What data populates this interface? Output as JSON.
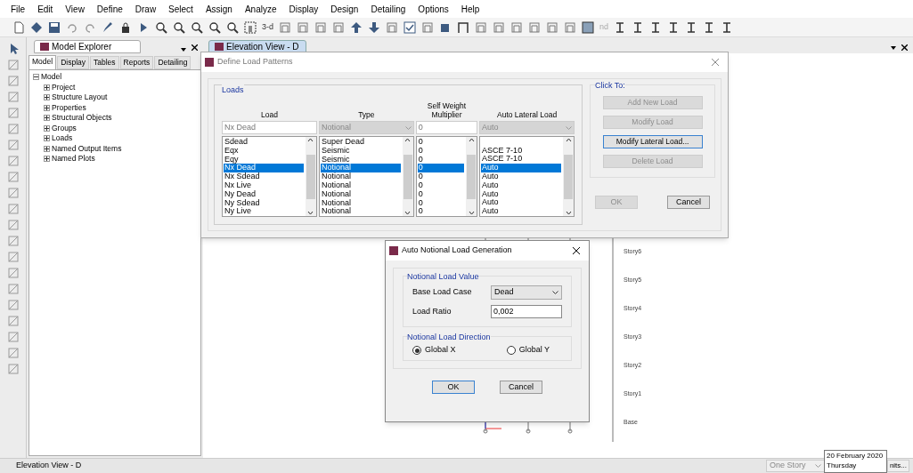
{
  "menu": [
    "File",
    "Edit",
    "View",
    "Define",
    "Draw",
    "Select",
    "Assign",
    "Analyze",
    "Display",
    "Design",
    "Detailing",
    "Options",
    "Help"
  ],
  "toolbar_labels": [
    "3-d",
    "nd"
  ],
  "explorer": {
    "title": "Model Explorer",
    "tabs": [
      {
        "label": "Model",
        "selected": true
      },
      {
        "label": "Display",
        "selected": false
      },
      {
        "label": "Tables",
        "selected": false
      },
      {
        "label": "Reports",
        "selected": false
      },
      {
        "label": "Detailing",
        "selected": false
      }
    ],
    "tree": [
      {
        "label": "Model",
        "expanded": true,
        "children": [
          {
            "label": "Project",
            "expanded": false
          },
          {
            "label": "Structure Layout",
            "expanded": false
          },
          {
            "label": "Properties",
            "expanded": false
          },
          {
            "label": "Structural Objects",
            "expanded": false
          },
          {
            "label": "Groups",
            "expanded": false
          },
          {
            "label": "Loads",
            "expanded": false
          },
          {
            "label": "Named Output Items",
            "expanded": false
          },
          {
            "label": "Named Plots",
            "expanded": false
          }
        ]
      }
    ]
  },
  "view_tab": "Elevation View - D",
  "stories": [
    "Story6",
    "Story5",
    "Story4",
    "Story3",
    "Story2",
    "Story1",
    "Base"
  ],
  "load_patterns": {
    "title": "Define Load Patterns",
    "group": "Loads",
    "columns": [
      "Load",
      "Type",
      "Self Weight Multiplier",
      "Auto Lateral Load"
    ],
    "edit_row": {
      "load": "Nx Dead",
      "type": "Notional",
      "multiplier": "0",
      "lateral": "Auto"
    },
    "rows": [
      {
        "load": "Sdead",
        "type": "Super Dead",
        "multiplier": "0",
        "selected": false
      },
      {
        "load": "Eqx",
        "type": "Seismic",
        "multiplier": "0",
        "lateral": "ASCE 7-10",
        "selected": false
      },
      {
        "load": "Eqy",
        "type": "Seismic",
        "multiplier": "0",
        "lateral": "ASCE 7-10",
        "selected": false
      },
      {
        "load": "Nx Dead",
        "type": "Notional",
        "multiplier": "0",
        "lateral": "Auto",
        "selected": true
      },
      {
        "load": "Nx Sdead",
        "type": "Notional",
        "multiplier": "0",
        "lateral": "Auto",
        "selected": false
      },
      {
        "load": "Nx Live",
        "type": "Notional",
        "multiplier": "0",
        "lateral": "Auto",
        "selected": false
      },
      {
        "load": "Ny Dead",
        "type": "Notional",
        "multiplier": "0",
        "lateral": "Auto",
        "selected": false
      },
      {
        "load": "Ny Sdead",
        "type": "Notional",
        "multiplier": "0",
        "lateral": "Auto",
        "selected": false
      },
      {
        "load": "Ny Live",
        "type": "Notional",
        "multiplier": "0",
        "lateral": "Auto",
        "selected": false
      }
    ],
    "click_to": "Click To:",
    "side_buttons": [
      {
        "label": "Add New Load",
        "disabled": true
      },
      {
        "label": "Modify Load",
        "disabled": true
      },
      {
        "label": "Modify Lateral Load...",
        "disabled": false
      },
      {
        "label": "Delete Load",
        "disabled": true
      }
    ],
    "ok": {
      "label": "OK",
      "disabled": true
    },
    "cancel": {
      "label": "Cancel",
      "disabled": false
    }
  },
  "notional": {
    "title": "Auto Notional Load Generation",
    "value_group": "Notional Load Value",
    "base_label": "Base Load Case",
    "base_value": "Dead",
    "ratio_label": "Load Ratio",
    "ratio_value": "0,002",
    "direction_group": "Notional Load Direction",
    "directions": [
      {
        "label": "Global X",
        "selected": true
      },
      {
        "label": "Global Y",
        "selected": false
      }
    ],
    "ok": "OK",
    "cancel": "Cancel"
  },
  "status_bar": {
    "view": "Elevation View - D",
    "story": "One Story",
    "tooltip": [
      "20 February 2020",
      "Thursday"
    ],
    "units": "nits..."
  }
}
